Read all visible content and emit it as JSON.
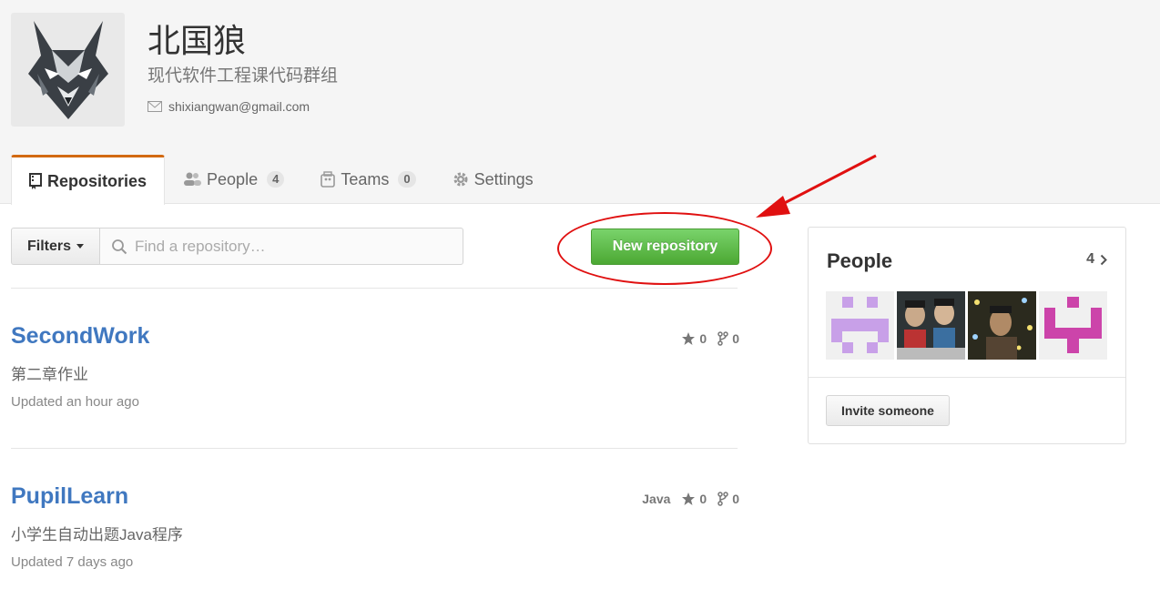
{
  "org": {
    "name": "北国狼",
    "description": "现代软件工程课代码群组",
    "email": "shixiangwan@gmail.com"
  },
  "tabs": [
    {
      "label": "Repositories",
      "active": true,
      "icon": "repo-icon"
    },
    {
      "label": "People",
      "count": "4",
      "icon": "people-icon"
    },
    {
      "label": "Teams",
      "count": "0",
      "icon": "teams-icon"
    },
    {
      "label": "Settings",
      "icon": "gear-icon"
    }
  ],
  "toolbar": {
    "filters_label": "Filters",
    "search_placeholder": "Find a repository…",
    "search_value": "",
    "new_repo_label": "New repository"
  },
  "repos": [
    {
      "name": "SecondWork",
      "description": "第二章作业",
      "updated": "Updated an hour ago",
      "language": "",
      "stars": "0",
      "forks": "0"
    },
    {
      "name": "PupilLearn",
      "description": "小学生自动出题Java程序",
      "updated": "Updated 7 days ago",
      "language": "Java",
      "stars": "0",
      "forks": "0"
    }
  ],
  "people": {
    "title": "People",
    "count": "4",
    "invite_label": "Invite someone"
  },
  "colors": {
    "accent_tab": "#d26911",
    "link": "#4078c0",
    "primary_button": "#55b63f",
    "annotation": "#e01010"
  }
}
